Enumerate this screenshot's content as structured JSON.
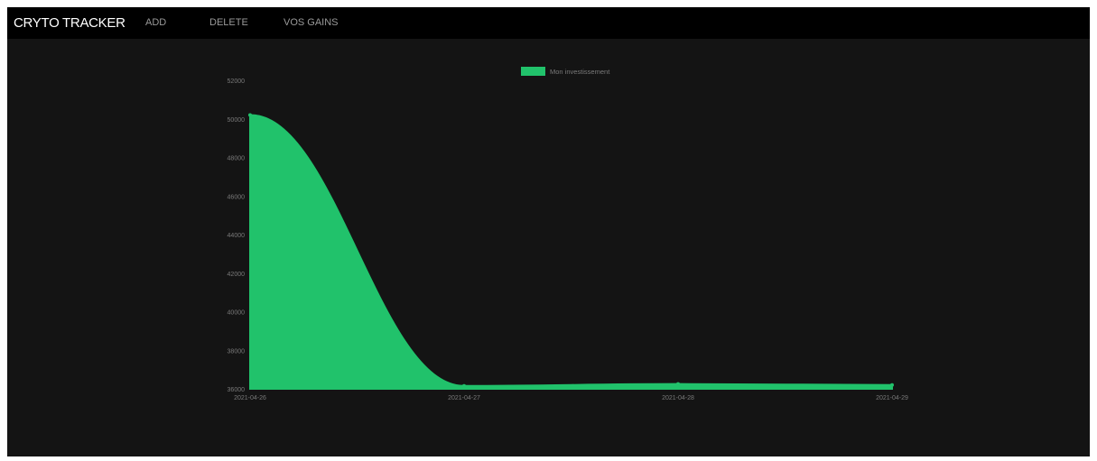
{
  "navbar": {
    "brand": "CRYTO TRACKER",
    "links": [
      "ADD",
      "DELETE",
      "VOS GAINS"
    ]
  },
  "colors": {
    "page_background": "#141414",
    "navbar_background": "#000000",
    "series_fill": "#21c26b",
    "tick_label": "#7a7a7a"
  },
  "chart_data": {
    "type": "area",
    "x": [
      "2021-04-26",
      "2021-04-27",
      "2021-04-28",
      "2021-04-29"
    ],
    "series": [
      {
        "name": "Mon investissement",
        "values": [
          50200,
          36150,
          36250,
          36200
        ]
      }
    ],
    "yticks": [
      "52000",
      "50000",
      "48000",
      "46000",
      "44000",
      "42000",
      "40000",
      "38000",
      "36000"
    ],
    "ylim": [
      36000,
      52000
    ],
    "legend_position": "top-center",
    "grid": false
  }
}
